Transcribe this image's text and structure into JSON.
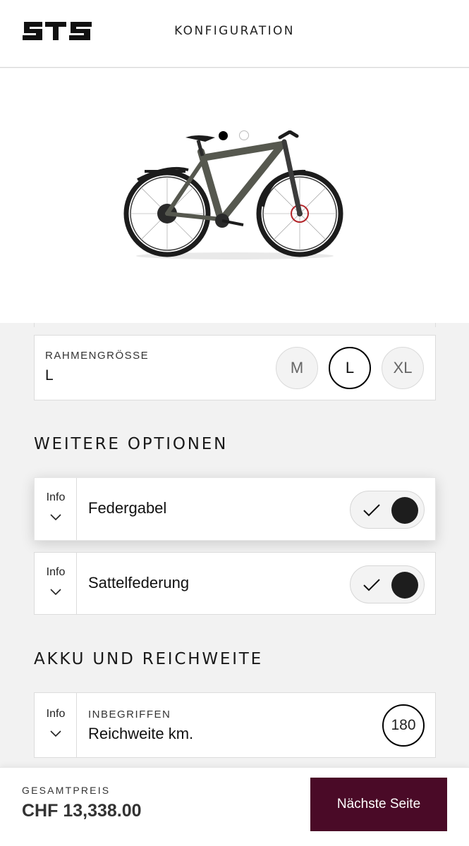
{
  "header": {
    "logo_text": "ST5",
    "title": "KONFIGURATION"
  },
  "carousel": {
    "slide_count": 2,
    "active_index": 0
  },
  "frame_size": {
    "label": "RAHMENGRÖSSE",
    "value": "L",
    "options": [
      "M",
      "L",
      "XL"
    ],
    "selected": "L"
  },
  "options_section": {
    "title": "WEITERE OPTIONEN",
    "items": [
      {
        "info_label": "Info",
        "label": "Federgabel",
        "enabled": true
      },
      {
        "info_label": "Info",
        "label": "Sattelfederung",
        "enabled": true
      }
    ]
  },
  "battery_section": {
    "title": "AKKU UND REICHWEITE",
    "range": {
      "info_label": "Info",
      "caption": "INBEGRIFFEN",
      "label": "Reichweite km.",
      "value": "180"
    }
  },
  "footer": {
    "total_label": "GESAMTPREIS",
    "total_value": "CHF 13,338.00",
    "next_button": "Nächste Seite"
  },
  "colors": {
    "primary_button": "#4a0a27",
    "bike_frame": "#56584f",
    "background": "#f2f2f2"
  },
  "icons": [
    "chevron-down-icon",
    "checkmark-icon",
    "bike-image"
  ]
}
